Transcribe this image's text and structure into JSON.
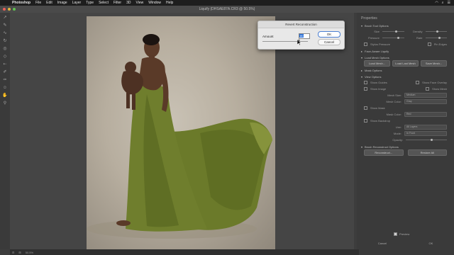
{
  "menubar": {
    "app": "Photoshop",
    "items": [
      "File",
      "Edit",
      "Image",
      "Layer",
      "Type",
      "Select",
      "Filter",
      "3D",
      "View",
      "Window",
      "Help"
    ]
  },
  "window": {
    "title": "Liquify (DHSAE87A.CR3 @ 50.5%)"
  },
  "panel": {
    "title": "Properties",
    "sections": [
      "Brush Tool Options",
      "Face-Aware Liquify",
      "Load Mesh Options",
      "Mask Options",
      "View Options",
      "Brush Reconstruct Options"
    ],
    "brush_labels": [
      "Size",
      "Density",
      "Pressure",
      "Rate"
    ],
    "checkboxes": [
      "Stylus Pressure",
      "Pin Edges"
    ],
    "mesh_buttons": [
      "Load Mesh...",
      "Load Last Mesh",
      "Save Mesh..."
    ],
    "view_items": [
      "Show Guides",
      "Show Face Overlay",
      "Show Image",
      "Show Mesh",
      "Show Mask",
      "Show Backdrop"
    ],
    "mesh_size_label": "Mesh Size:",
    "mesh_size_value": "Medium",
    "mesh_color_label": "Mesh Color:",
    "mesh_color_value": "Gray",
    "mask_color_label": "Mask Color:",
    "mask_color_value": "Red",
    "use_label": "Use:",
    "use_value": "All Layers",
    "mode_label": "Mode:",
    "mode_value": "In Front",
    "opacity_label": "Opacity:",
    "reconstruct_buttons": [
      "Reconstruct...",
      "Restore All"
    ],
    "preview_label": "Preview",
    "cancel_label": "Cancel",
    "ok_label": "OK"
  },
  "dialog": {
    "title": "Revert Reconstruction",
    "amount_label": "Amount",
    "amount_value": "80",
    "amount_fraction": 0.8,
    "ok_label": "OK",
    "cancel_label": "Cancel"
  },
  "bottombar": {
    "zoom": "50.5%"
  },
  "colors": {
    "accent": "#2a6fd6",
    "dress_green": "#6b7a2a",
    "backdrop": "#bdb4a5"
  }
}
